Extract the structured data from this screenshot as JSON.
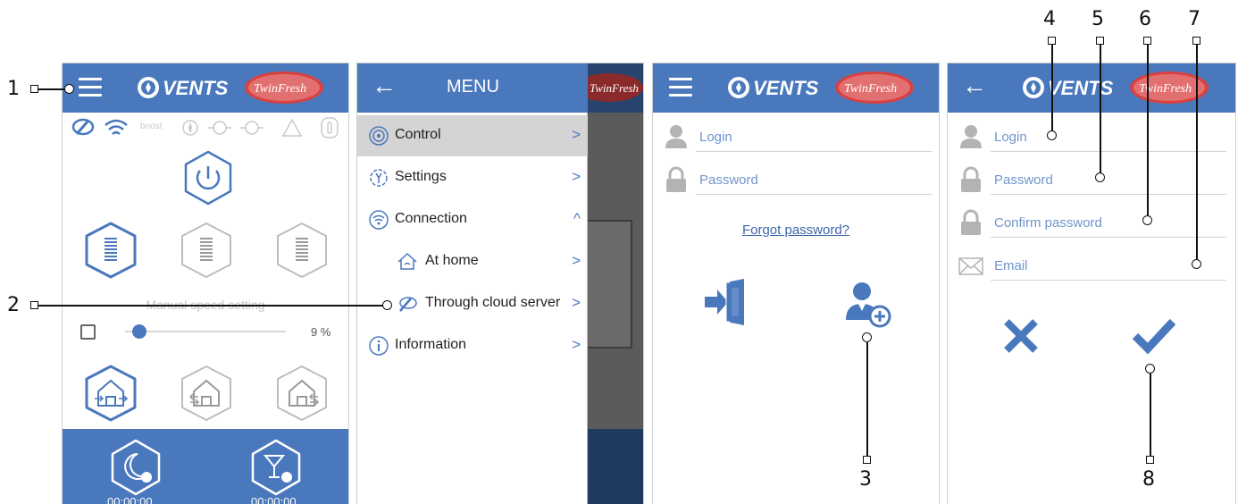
{
  "colors": {
    "primary": "#4a78bd",
    "link": "#3d64a8",
    "inactive_icon": "#bdbdbd"
  },
  "brand": {
    "vents": "VENTS",
    "twinfresh": "TwinFresh"
  },
  "screen1": {
    "status_boost": "boost",
    "manual_speed_label": "Manual speed setting",
    "speed_value": "9 %",
    "speed_fraction": 0.09,
    "timer_night": "00:00:00",
    "timer_party": "00:00:00"
  },
  "menu": {
    "title": "MENU",
    "items": [
      {
        "label": "Control",
        "icon": "control-icon",
        "chevron": ">"
      },
      {
        "label": "Settings",
        "icon": "settings-icon",
        "chevron": ">"
      },
      {
        "label": "Connection",
        "icon": "wifi-icon",
        "chevron": "^"
      },
      {
        "label": "At home",
        "icon": "home-icon",
        "chevron": ">"
      },
      {
        "label": "Through cloud server",
        "icon": "cloud-icon",
        "chevron": ">"
      },
      {
        "label": "Information",
        "icon": "info-icon",
        "chevron": ">"
      }
    ]
  },
  "login": {
    "login_placeholder": "Login",
    "password_placeholder": "Password",
    "forgot": "Forgot password?"
  },
  "register": {
    "login_placeholder": "Login",
    "password_placeholder": "Password",
    "confirm_placeholder": "Confirm password",
    "email_placeholder": "Email"
  },
  "annotations": [
    "1",
    "2",
    "3",
    "4",
    "5",
    "6",
    "7",
    "8"
  ]
}
